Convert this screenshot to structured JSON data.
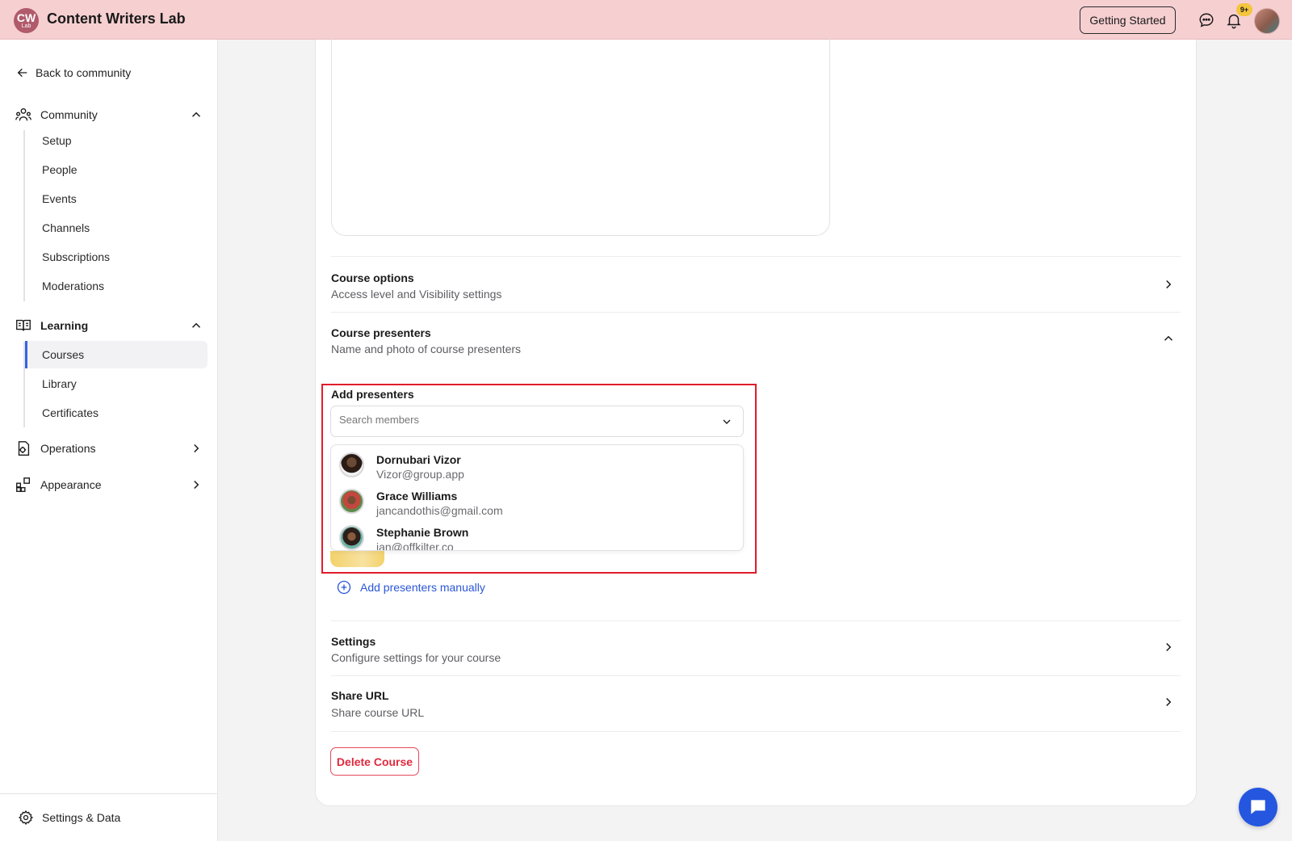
{
  "header": {
    "logo_text": "CW",
    "logo_sub": "Lab",
    "app_title": "Content Writers Lab",
    "getting_started_label": "Getting Started",
    "notification_badge": "9+"
  },
  "sidebar": {
    "back_label": "Back to community",
    "community": {
      "label": "Community",
      "items": [
        "Setup",
        "People",
        "Events",
        "Channels",
        "Subscriptions",
        "Moderations"
      ]
    },
    "learning": {
      "label": "Learning",
      "items": [
        "Courses",
        "Library",
        "Certificates"
      ],
      "active": "Courses"
    },
    "operations_label": "Operations",
    "appearance_label": "Appearance",
    "footer_label": "Settings & Data"
  },
  "main": {
    "course_options": {
      "title": "Course options",
      "subtitle": "Access level and Visibility settings"
    },
    "course_presenters": {
      "title": "Course presenters",
      "subtitle": "Name and photo of course presenters"
    },
    "add_presenters_label": "Add presenters",
    "search_placeholder": "Search members",
    "members": [
      {
        "name": "Dornubari Vizor",
        "email": "Vizor@group.app"
      },
      {
        "name": "Grace Williams",
        "email": "jancandothis@gmail.com"
      },
      {
        "name": "Stephanie Brown",
        "email": "ian@offkilter.co"
      }
    ],
    "add_manually_label": "Add presenters manually",
    "settings": {
      "title": "Settings",
      "subtitle": "Configure settings for your course"
    },
    "share_url": {
      "title": "Share URL",
      "subtitle": "Share course URL"
    },
    "delete_label": "Delete Course"
  },
  "colors": {
    "topbar": "#f6cfd1",
    "accent_blue": "#2456e0",
    "danger": "#e0293e",
    "highlight_box": "#e11d2b"
  },
  "icons": [
    "chat-bubble-icon",
    "bell-icon",
    "arrow-left-icon",
    "community-icon",
    "book-icon",
    "operations-icon",
    "appearance-icon",
    "gear-icon",
    "chevron-up-icon",
    "chevron-right-icon",
    "chevron-down-icon",
    "plus-circle-icon"
  ]
}
